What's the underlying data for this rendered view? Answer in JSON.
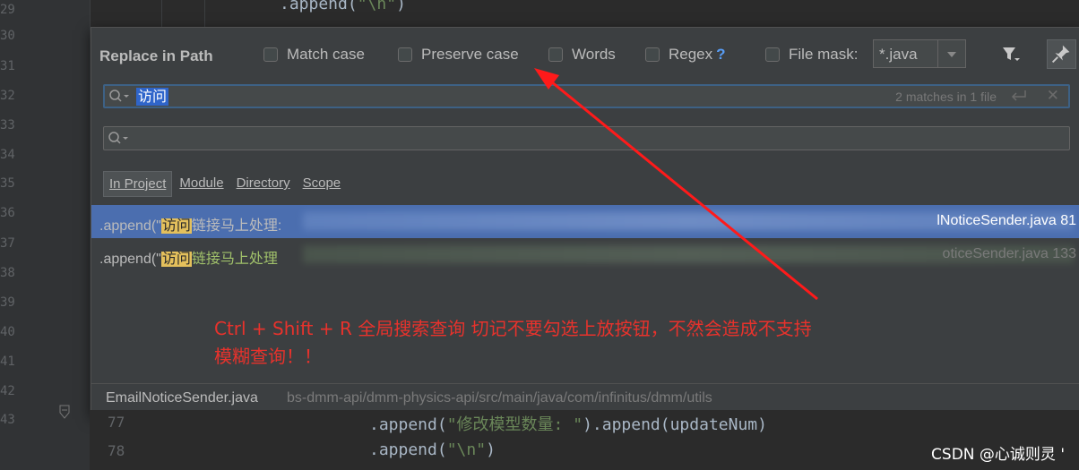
{
  "editor": {
    "line_numbers": [
      "29",
      "30",
      "31",
      "32",
      "33",
      "34",
      "35",
      "36",
      "37",
      "38",
      "39",
      "40",
      "41",
      "42",
      "43"
    ],
    "top_code": {
      "method": ".append(",
      "string": "\"\\n\"",
      "close": ")"
    },
    "top_code_faded": "...",
    "bottom_lines": [
      {
        "number": "77",
        "method": ".append(",
        "string": "\"修改模型数量: \"",
        "tail": ").append(updateNum)"
      },
      {
        "number": "78",
        "method": ".append(",
        "string": "\"\\n\"",
        "tail": ")"
      }
    ]
  },
  "dialog": {
    "title": "Replace in Path",
    "options": [
      {
        "label": "Match case",
        "checked": false
      },
      {
        "label": "Preserve case",
        "checked": false
      },
      {
        "label": "Words",
        "checked": false
      },
      {
        "label": "Regex",
        "checked": false,
        "help": "?"
      },
      {
        "label": "File mask:",
        "checked": false
      }
    ],
    "file_mask_value": "*.java",
    "search": {
      "query": "访问",
      "match_count": "2 matches in 1 file"
    },
    "replace": {
      "value": ""
    },
    "scope_tabs": [
      {
        "label": "In Project",
        "selected": true
      },
      {
        "label": "Module",
        "selected": false
      },
      {
        "label": "Directory",
        "selected": false
      },
      {
        "label": "Scope",
        "selected": false
      }
    ],
    "results": [
      {
        "prefix": ".append(\"",
        "match": "访问",
        "after": "链接马上处理:",
        "file": "lNoticeSender.java 81",
        "selected": true
      },
      {
        "prefix": ".append(\"",
        "match": "访问",
        "after": "链接马上处理",
        "file": "oticeSender.java 133",
        "selected": false
      }
    ],
    "annotation_line1": "Ctrl + Shift + R 全局搜索查询   切记不要勾选上放按钮，不然会造成不支持",
    "annotation_line2": "模糊查询！！",
    "status": {
      "file_name": "EmailNoticeSender.java",
      "path": "bs-dmm-api/dmm-physics-api/src/main/java/com/infinitus/dmm/utils"
    }
  },
  "watermark": "CSDN @心诚则灵 '",
  "colors": {
    "accent": "#4b6eaf",
    "highlight": "#e4c05c",
    "annotation": "#e8322c"
  }
}
